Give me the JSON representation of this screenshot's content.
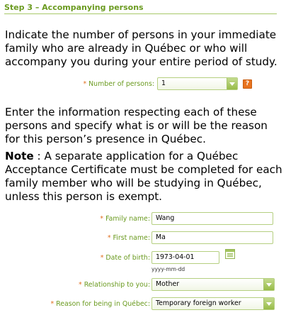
{
  "step": {
    "title": "Step 3 – Accompanying persons"
  },
  "intro_text": "Indicate the number of persons in your immediate family who are already in Québec or who will accompany you during your entire period of study.",
  "number_of_persons": {
    "label": "Number of persons:",
    "value": "1",
    "help_icon": "question-mark"
  },
  "info_text": "Enter the information respecting each of these persons and specify what is or will be the reason for this person’s presence in Québec.",
  "note": {
    "label": "Note",
    "text": " : A separate application for a Québec Acceptance Certificate must be completed for each family member who will be studying in Québec, unless this person is exempt."
  },
  "required_marker": "*",
  "person": {
    "family_name": {
      "label": "Family name:",
      "value": "Wang"
    },
    "first_name": {
      "label": "First name:",
      "value": "Ma"
    },
    "date_of_birth": {
      "label": "Date of birth:",
      "value": "1973-04-01",
      "format_hint": "yyyy-mm-dd",
      "icon": "calendar-icon"
    },
    "relationship": {
      "label": "Relationship to you:",
      "value": "Mother"
    },
    "reason": {
      "label": "Reason for being in Québec:",
      "value": "Temporary foreign worker"
    }
  },
  "colors": {
    "accent_green": "#6a9a1f",
    "required_orange": "#e07020",
    "field_border": "#b5cf80"
  }
}
